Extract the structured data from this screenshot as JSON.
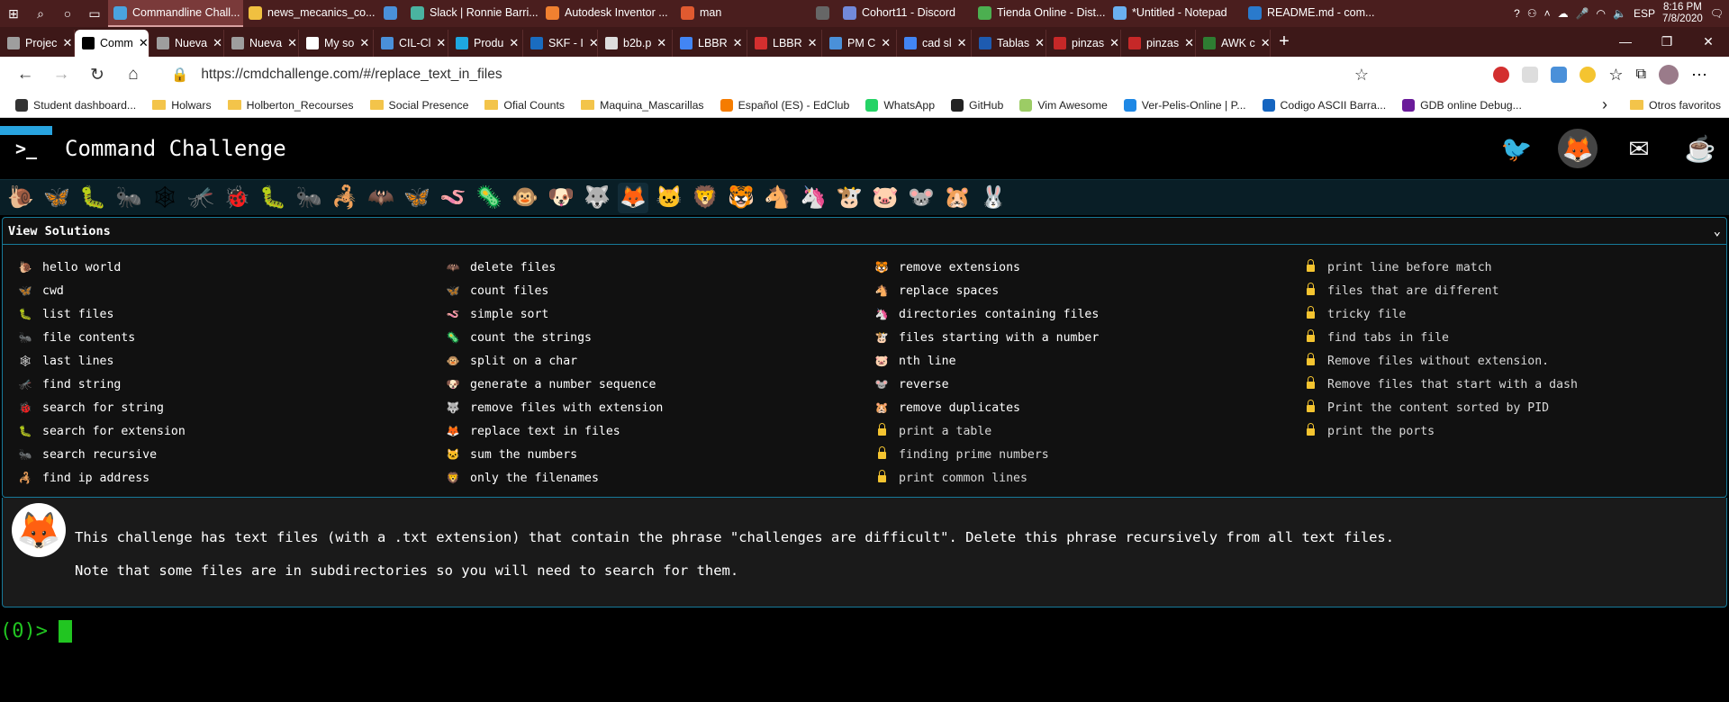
{
  "taskbar": {
    "apps": [
      {
        "label": "Commandline Chall...",
        "color": "#4aa3df",
        "active": true
      },
      {
        "label": "news_mecanics_co...",
        "color": "#f0c040"
      },
      {
        "label": "",
        "color": "#4a90d9"
      },
      {
        "label": "Slack | Ronnie Barri...",
        "color": "#4ab3a0"
      },
      {
        "label": "Autodesk Inventor ...",
        "color": "#f08030"
      },
      {
        "label": "man",
        "color": "#e05a30"
      },
      {
        "label": "",
        "color": "#666"
      },
      {
        "label": "Cohort11 - Discord",
        "color": "#7289da"
      },
      {
        "label": "Tienda Online - Dist...",
        "color": "#4caf50"
      },
      {
        "label": "*Untitled - Notepad",
        "color": "#6ab0f0"
      },
      {
        "label": "README.md - com...",
        "color": "#2a7acc"
      }
    ],
    "lang": "ESP",
    "time": "8:16 PM",
    "date": "7/8/2020"
  },
  "tabs": [
    {
      "label": "Projec",
      "fav": "#9e9e9e"
    },
    {
      "label": "Comm",
      "fav": "#000",
      "active": true
    },
    {
      "label": "Nueva",
      "fav": "#9e9e9e"
    },
    {
      "label": "Nueva",
      "fav": "#9e9e9e"
    },
    {
      "label": "My so",
      "fav": "#fff"
    },
    {
      "label": "CIL-Cl",
      "fav": "#4a90d9"
    },
    {
      "label": "Produ",
      "fav": "#1ea7e0"
    },
    {
      "label": "SKF - I",
      "fav": "#1a6cc0"
    },
    {
      "label": "b2b.p",
      "fav": "#ddd"
    },
    {
      "label": "LBBR",
      "fav": "#4285f4"
    },
    {
      "label": "LBBR",
      "fav": "#d32f2f"
    },
    {
      "label": "PM C",
      "fav": "#4a90d9"
    },
    {
      "label": "cad sl",
      "fav": "#4285f4"
    },
    {
      "label": "Tablas",
      "fav": "#1e5bb0"
    },
    {
      "label": "pinzas",
      "fav": "#c62828"
    },
    {
      "label": "pinzas",
      "fav": "#c62828"
    },
    {
      "label": "AWK c",
      "fav": "#2e7d32"
    }
  ],
  "address": {
    "url": "https://cmdchallenge.com/#/replace_text_in_files"
  },
  "bookmarks": [
    {
      "label": "Student dashboard...",
      "type": "icon",
      "color": "#333"
    },
    {
      "label": "Holwars",
      "type": "folder"
    },
    {
      "label": "Holberton_Recourses",
      "type": "folder"
    },
    {
      "label": "Social Presence",
      "type": "folder"
    },
    {
      "label": "Ofial Counts",
      "type": "folder"
    },
    {
      "label": "Maquina_Mascarillas",
      "type": "folder"
    },
    {
      "label": "Español (ES) - EdClub",
      "type": "icon",
      "color": "#f57c00"
    },
    {
      "label": "WhatsApp",
      "type": "icon",
      "color": "#25d366"
    },
    {
      "label": "GitHub",
      "type": "icon",
      "color": "#222"
    },
    {
      "label": "Vim Awesome",
      "type": "icon",
      "color": "#9ccc65"
    },
    {
      "label": "Ver-Pelis-Online | P...",
      "type": "icon",
      "color": "#1e88e5"
    },
    {
      "label": "Codigo ASCII Barra...",
      "type": "icon",
      "color": "#1565c0"
    },
    {
      "label": "GDB online Debug...",
      "type": "icon",
      "color": "#6a1b9a"
    },
    {
      "label": "Otros favoritos",
      "type": "folder"
    }
  ],
  "site": {
    "logo_text": ">_",
    "title": "Command Challenge"
  },
  "animals": [
    "🐌",
    "🦋",
    "🐛",
    "🐜",
    "🕸",
    "🦟",
    "🐞",
    "🐛",
    "🐜",
    "🦂",
    "🦇",
    "🦋",
    "🪱",
    "🦠",
    "🐵",
    "🐶",
    "🐺",
    "🦊",
    "🐱",
    "🦁",
    "🐯",
    "🐴",
    "🦄",
    "🐮",
    "🐷",
    "🐭",
    "🐹",
    "🐰"
  ],
  "solutions": {
    "header": "View Solutions",
    "columns": [
      [
        {
          "emoji": "🐌",
          "label": "hello world"
        },
        {
          "emoji": "🦋",
          "label": "cwd"
        },
        {
          "emoji": "🐛",
          "label": "list files"
        },
        {
          "emoji": "🐜",
          "label": "file contents"
        },
        {
          "emoji": "🕸",
          "label": "last lines"
        },
        {
          "emoji": "🦟",
          "label": "find string"
        },
        {
          "emoji": "🐞",
          "label": "search for string"
        },
        {
          "emoji": "🐛",
          "label": "search for extension"
        },
        {
          "emoji": "🐜",
          "label": "search recursive"
        },
        {
          "emoji": "🦂",
          "label": "find ip address"
        }
      ],
      [
        {
          "emoji": "🦇",
          "label": "delete files"
        },
        {
          "emoji": "🦋",
          "label": "count files"
        },
        {
          "emoji": "🪱",
          "label": "simple sort"
        },
        {
          "emoji": "🦠",
          "label": "count the strings"
        },
        {
          "emoji": "🐵",
          "label": "split on a char"
        },
        {
          "emoji": "🐶",
          "label": "generate a number sequence"
        },
        {
          "emoji": "🐺",
          "label": "remove files with extension"
        },
        {
          "emoji": "🦊",
          "label": "replace text in files"
        },
        {
          "emoji": "🐱",
          "label": "sum the numbers"
        },
        {
          "emoji": "🦁",
          "label": "only the filenames"
        }
      ],
      [
        {
          "emoji": "🐯",
          "label": "remove extensions"
        },
        {
          "emoji": "🐴",
          "label": "replace spaces"
        },
        {
          "emoji": "🦄",
          "label": "directories containing files"
        },
        {
          "emoji": "🐮",
          "label": "files starting with a number"
        },
        {
          "emoji": "🐷",
          "label": "nth line"
        },
        {
          "emoji": "🐭",
          "label": "reverse"
        },
        {
          "emoji": "🐹",
          "label": "remove duplicates"
        },
        {
          "emoji": "",
          "label": "print a table",
          "locked": true
        },
        {
          "emoji": "",
          "label": "finding prime numbers",
          "locked": true
        },
        {
          "emoji": "",
          "label": "print common lines",
          "locked": true
        }
      ],
      [
        {
          "emoji": "",
          "label": "print line before match",
          "locked": true
        },
        {
          "emoji": "",
          "label": "files that are different",
          "locked": true
        },
        {
          "emoji": "",
          "label": "tricky file",
          "locked": true
        },
        {
          "emoji": "",
          "label": "find tabs in file",
          "locked": true
        },
        {
          "emoji": "",
          "label": "Remove files without extension.",
          "locked": true
        },
        {
          "emoji": "",
          "label": "Remove files that start with a dash",
          "locked": true
        },
        {
          "emoji": "",
          "label": "Print the content sorted by PID",
          "locked": true
        },
        {
          "emoji": "",
          "label": "print the ports",
          "locked": true
        }
      ]
    ]
  },
  "challenge": {
    "avatar": "🦊",
    "line1": "This challenge has text files (with a .txt extension) that contain the phrase \"challenges are difficult\". Delete this phrase recursively from all text files.",
    "line2": "Note that some files are in subdirectories so you will need to search for them."
  },
  "prompt": {
    "text": "(0)>"
  }
}
